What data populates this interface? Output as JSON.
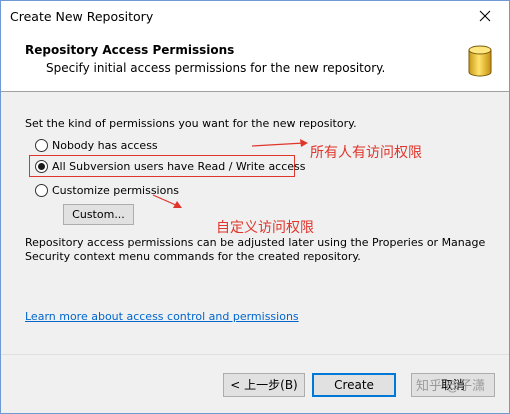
{
  "window": {
    "title": "Create New Repository"
  },
  "header": {
    "title": "Repository Access Permissions",
    "subtitle": "Specify initial access permissions for the new repository."
  },
  "content": {
    "instruction": "Set the kind of permissions you want for the new repository.",
    "options": [
      {
        "label": "Nobody has access",
        "checked": false
      },
      {
        "label": "All Subversion users have Read / Write access",
        "checked": true
      },
      {
        "label": "Customize permissions",
        "checked": false
      }
    ],
    "custom_button": "Custom...",
    "note": "Repository access permissions can be adjusted later using the Properies or Manage Security context menu commands for the created repository.",
    "learn_more": "Learn more about access control and permissions"
  },
  "annotations": {
    "all_users": "所有人有访问权限",
    "custom": "自定义访问权限"
  },
  "footer": {
    "back": "< 上一步(B)",
    "create": "Create",
    "cancel": "取消"
  },
  "watermark": "知乎 @子潇",
  "colors": {
    "annotation": "#e0352b",
    "link": "#0066cc",
    "accent": "#0078d7"
  },
  "icons": {
    "close": "close-icon",
    "header": "database-icon"
  }
}
